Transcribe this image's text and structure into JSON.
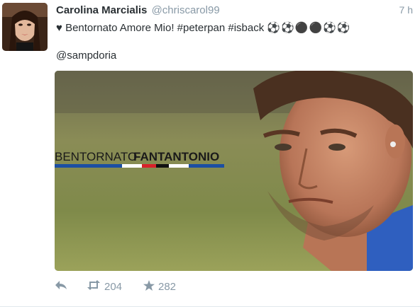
{
  "tweet": {
    "fullname": "Carolina Marcialis",
    "username": "@chriscarol99",
    "timestamp": "7 h",
    "text": "Bentornato Amore Mio! #peterpan #isback",
    "balls": "⚽⚽⚫⚫⚽⚽",
    "mention": "@sampdoria"
  },
  "media": {
    "overlay_light": "BENTORNATO",
    "overlay_bold": "FANTANTONIO",
    "stripe_colors": [
      "#1c4fa3",
      "#ffffff",
      "#d8232a",
      "#111111",
      "#ffffff",
      "#1c4fa3"
    ]
  },
  "actions": {
    "retweet_count": "204",
    "favorite_count": "282"
  },
  "colors": {
    "text": "#292f33",
    "muted": "#8899a6",
    "shirt_blue": "#2f5fbf"
  },
  "icons": [
    "heart-icon",
    "soccer-ball-icon",
    "reply-icon",
    "retweet-icon",
    "star-icon"
  ]
}
